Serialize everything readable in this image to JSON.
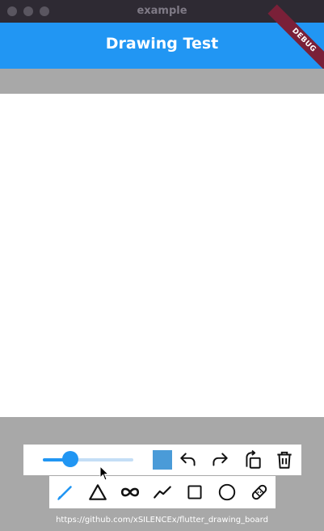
{
  "window": {
    "title": "example"
  },
  "appbar": {
    "title": "Drawing Test",
    "debug_label": "DEBUG"
  },
  "toolbar": {
    "stroke_width_value": 0.3,
    "current_color": "#4a9bd8",
    "accent_color": "#2196f3",
    "actions": [
      "undo-icon",
      "redo-icon",
      "rotate-icon",
      "delete-icon"
    ],
    "tools": [
      "pen-icon",
      "triangle-icon",
      "infinity-icon",
      "polyline-icon",
      "rectangle-icon",
      "circle-icon",
      "eraser-icon"
    ],
    "selected_tool": "pen-icon"
  },
  "footer": {
    "link_text": "https://github.com/xSILENCEx/flutter_drawing_board"
  }
}
